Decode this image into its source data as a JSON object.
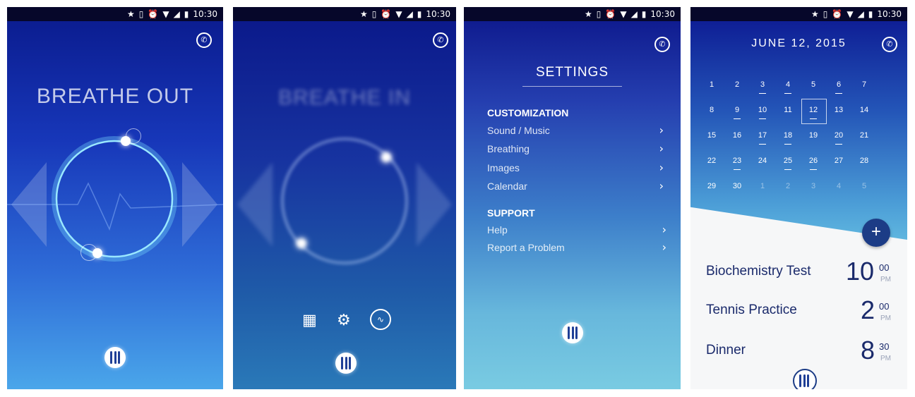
{
  "status": {
    "time": "10:30",
    "icons": [
      "star-icon",
      "vibrate-icon",
      "alarm-icon",
      "wifi-icon",
      "signal-icon",
      "battery-icon"
    ]
  },
  "screen1": {
    "title": "BREATHE OUT"
  },
  "screen2": {
    "title": "BREATHE IN"
  },
  "screen3": {
    "title": "SETTINGS",
    "customization_heading": "CUSTOMIZATION",
    "customization_items": [
      "Sound / Music",
      "Breathing",
      "Images",
      "Calendar"
    ],
    "support_heading": "SUPPORT",
    "support_items": [
      "Help",
      "Report a Problem"
    ]
  },
  "screen4": {
    "date": "JUNE 12, 2015",
    "weeks": [
      [
        "1",
        "2",
        "3",
        "4",
        "5",
        "6",
        "7"
      ],
      [
        "8",
        "9",
        "10",
        "11",
        "12",
        "13",
        "14"
      ],
      [
        "15",
        "16",
        "17",
        "18",
        "19",
        "20",
        "21"
      ],
      [
        "22",
        "23",
        "24",
        "25",
        "26",
        "27",
        "28"
      ],
      [
        "29",
        "30",
        "1",
        "2",
        "3",
        "4",
        "5"
      ]
    ],
    "selected_day": "12",
    "event_days": [
      "3",
      "4",
      "6",
      "9",
      "10",
      "12",
      "17",
      "18",
      "20",
      "23",
      "25",
      "26"
    ],
    "fab_label": "+",
    "events": [
      {
        "name": "Biochemistry Test",
        "hour": "10",
        "minute": "00",
        "ampm": "PM"
      },
      {
        "name": "Tennis Practice",
        "hour": "2",
        "minute": "00",
        "ampm": "PM"
      },
      {
        "name": "Dinner",
        "hour": "8",
        "minute": "30",
        "ampm": "PM"
      }
    ]
  },
  "colors": {
    "accent": "#1a2a6b",
    "fab": "#1c3c86"
  }
}
